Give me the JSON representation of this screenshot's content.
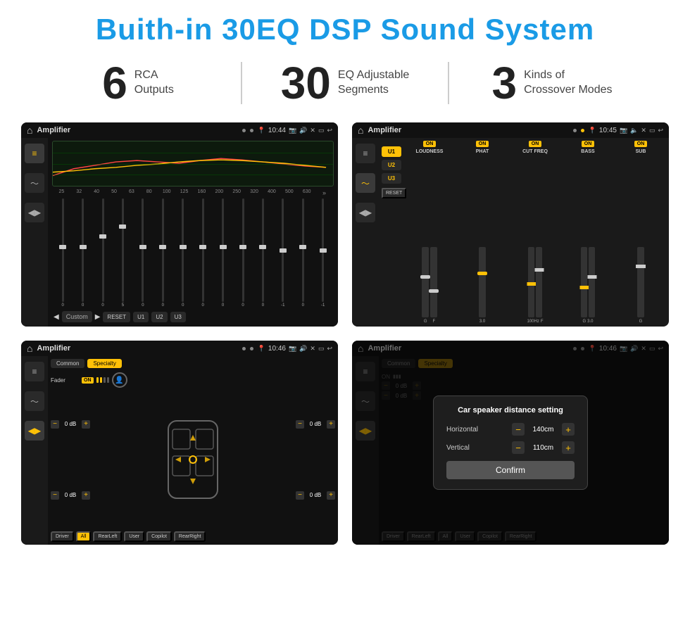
{
  "header": {
    "title": "Buith-in 30EQ DSP Sound System"
  },
  "stats": [
    {
      "number": "6",
      "desc_line1": "RCA",
      "desc_line2": "Outputs"
    },
    {
      "number": "30",
      "desc_line1": "EQ Adjustable",
      "desc_line2": "Segments"
    },
    {
      "number": "3",
      "desc_line1": "Kinds of",
      "desc_line2": "Crossover Modes"
    }
  ],
  "screens": [
    {
      "id": "screen-eq",
      "status_title": "Amplifier",
      "status_time": "10:44",
      "eq_freqs": [
        "25",
        "32",
        "40",
        "50",
        "63",
        "80",
        "100",
        "125",
        "160",
        "200",
        "250",
        "320",
        "400",
        "500",
        "630"
      ],
      "eq_values": [
        "0",
        "0",
        "0",
        "5",
        "0",
        "0",
        "0",
        "0",
        "0",
        "0",
        "0",
        "-1",
        "0",
        "-1"
      ],
      "eq_preset": "Custom",
      "eq_btns": [
        "RESET",
        "U1",
        "U2",
        "U3"
      ]
    },
    {
      "id": "screen-amp",
      "status_title": "Amplifier",
      "status_time": "10:45",
      "presets": [
        "U1",
        "U2",
        "U3"
      ],
      "channels": [
        {
          "label": "LOUDNESS",
          "on": true
        },
        {
          "label": "PHAT",
          "on": true
        },
        {
          "label": "CUT FREQ",
          "on": true
        },
        {
          "label": "BASS",
          "on": true
        },
        {
          "label": "SUB",
          "on": true
        }
      ],
      "reset_label": "RESET"
    },
    {
      "id": "screen-fader",
      "status_title": "Amplifier",
      "status_time": "10:46",
      "tabs": [
        "Common",
        "Specialty"
      ],
      "fader_label": "Fader",
      "fader_on": "ON",
      "speaker_rows": [
        {
          "val": "0 dB"
        },
        {
          "val": "0 dB"
        },
        {
          "val": "0 dB"
        },
        {
          "val": "0 dB"
        }
      ],
      "bottom_btns": [
        "Driver",
        "RearLeft",
        "All",
        "User",
        "Copilot",
        "RearRight"
      ]
    },
    {
      "id": "screen-dialog",
      "status_title": "Amplifier",
      "status_time": "10:46",
      "tabs": [
        "Common",
        "Specialty"
      ],
      "dialog": {
        "title": "Car speaker distance setting",
        "fields": [
          {
            "label": "Horizontal",
            "value": "140cm"
          },
          {
            "label": "Vertical",
            "value": "110cm"
          }
        ],
        "confirm_label": "Confirm"
      },
      "bottom_btns": [
        "Driver",
        "RearLeft",
        "All",
        "User",
        "Copilot",
        "RearRight"
      ]
    }
  ]
}
